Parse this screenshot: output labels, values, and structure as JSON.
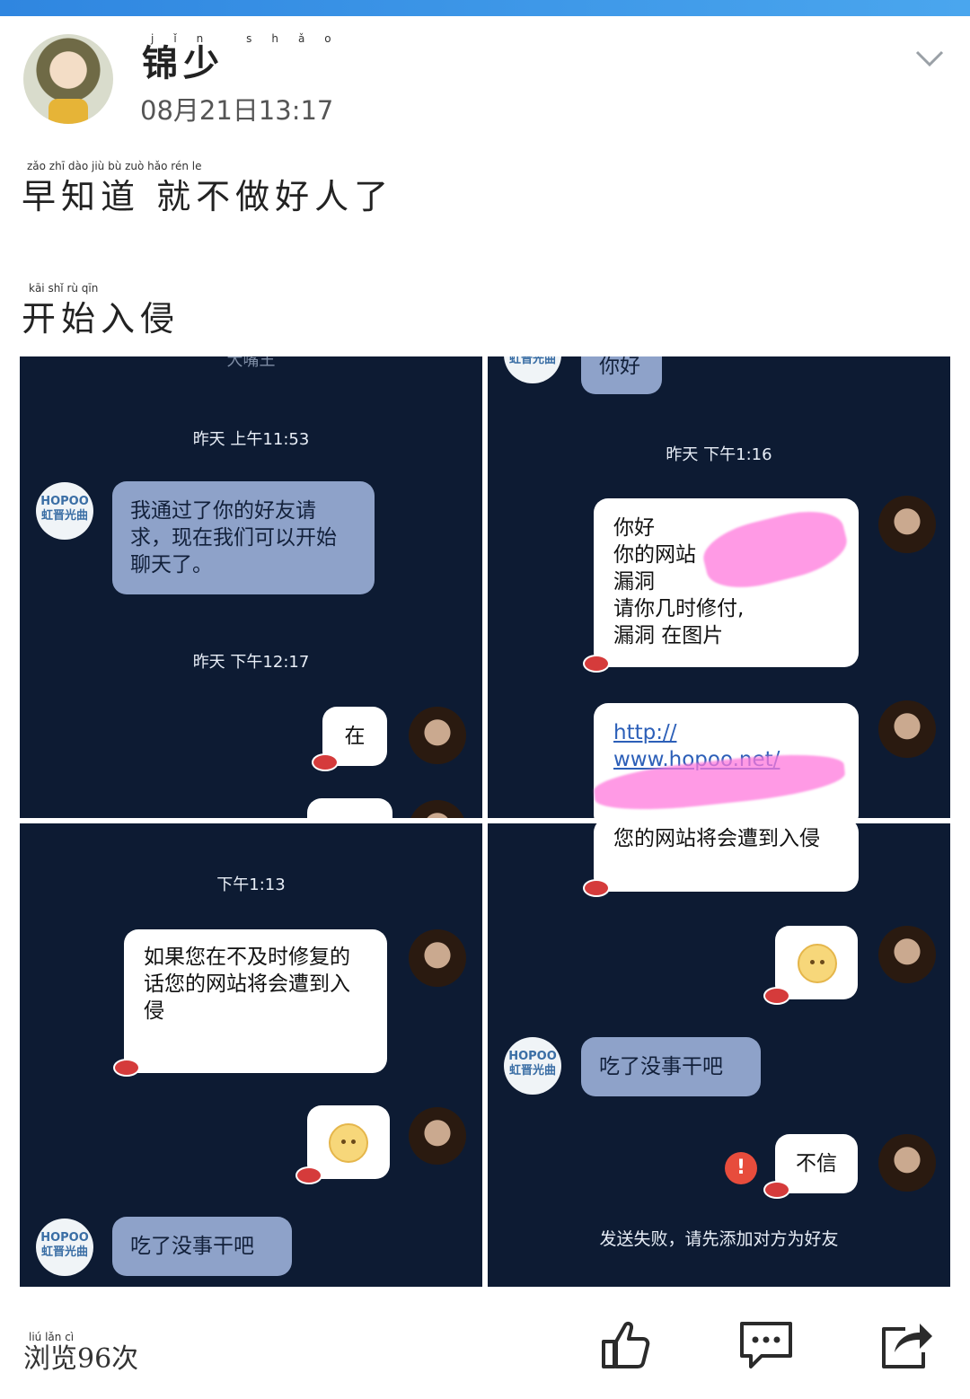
{
  "header": {
    "username": "锦少",
    "username_pinyin": "jǐn shǎo",
    "timestamp": "08月21日13:17",
    "expand_icon": "chevron-down-icon"
  },
  "post": {
    "line1_pinyin": "zǎo zhī dào    jiù bù zuò hǎo rén le",
    "line1_text": "早知道 就不做好人了",
    "line2_pinyin": "kāi shǐ rù qīn",
    "line2_text": "开始入侵"
  },
  "screenshots": {
    "p1": {
      "top_cut": "大嘴王",
      "ts1": "昨天 上午11:53",
      "msg1": "我通过了你的好友请求，现在我们可以开始聊天了。",
      "ts2": "昨天 下午12:17",
      "msg2": "在",
      "logo_text": "HOPOO\n虹晋光曲"
    },
    "p2": {
      "top_msg": "你好",
      "ts1": "昨天 下午1:16",
      "msg1_l1": "你好",
      "msg1_l2": "你的网站",
      "msg1_l3": "漏洞",
      "msg1_l4": "请你几时修付,",
      "msg1_l5": "漏洞 在图片",
      "link_l1": "http://",
      "link_l2": "www.hopoo.net/"
    },
    "p3": {
      "ts1": "下午1:13",
      "msg1": "如果您在不及时修复的话您的网站将会遭到入侵",
      "msg2": "吃了没事干吧"
    },
    "p4": {
      "msg1": "您的网站将会遭到入侵",
      "msg2": "吃了没事干吧",
      "msg3": "不信",
      "error_mark": "!",
      "fail_text": "发送失败，请先添加对方为好友"
    }
  },
  "footer": {
    "views_pinyin": "liú lǎn cì",
    "views": "浏览96次",
    "like_icon": "thumbs-up-icon",
    "comment_icon": "comment-icon",
    "share_icon": "share-icon"
  }
}
